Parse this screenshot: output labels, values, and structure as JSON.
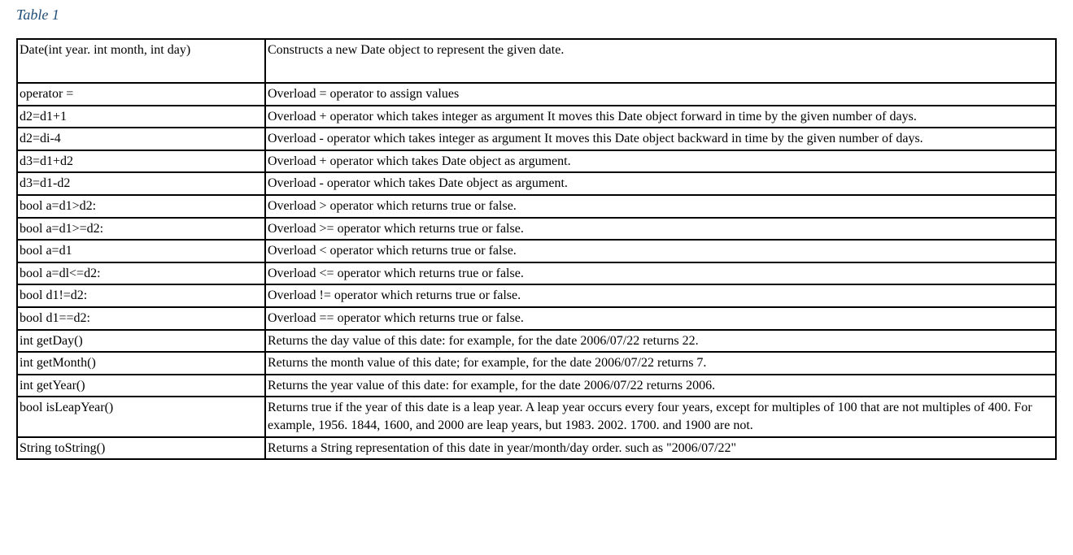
{
  "title": "Table 1",
  "rows": [
    {
      "tall": true,
      "sig": "Date(int year. int month, int day)",
      "desc": "Constructs a new Date object to represent the given date."
    },
    {
      "tall": false,
      "sig": "operator =",
      "desc": "Overload = operator to assign values"
    },
    {
      "tall": false,
      "sig": "d2=d1+1",
      "desc": "Overload + operator which takes integer as argument It moves this Date object forward in time by the given number of days."
    },
    {
      "tall": false,
      "sig": "d2=di-4",
      "desc": "Overload - operator which takes integer as argument It moves this Date object backward in time by the given number of days."
    },
    {
      "tall": false,
      "sig": "d3=d1+d2",
      "desc": "Overload + operator which takes Date object as argument."
    },
    {
      "tall": false,
      "sig": "d3=d1-d2",
      "desc": "Overload - operator which takes Date object as argument."
    },
    {
      "tall": false,
      "sig": "bool a=d1>d2:",
      "desc": "Overload > operator which returns true or false."
    },
    {
      "tall": false,
      "sig": "bool a=d1>=d2:",
      "desc": "Overload >= operator which returns true or false."
    },
    {
      "tall": false,
      "sig": "bool a=d1",
      "desc": "Overload < operator which returns true or false."
    },
    {
      "tall": false,
      "sig": "bool a=dl<=d2:",
      "desc": "Overload <= operator which returns true or false."
    },
    {
      "tall": false,
      "sig": "bool d1!=d2:",
      "desc": "Overload != operator which returns true or false."
    },
    {
      "tall": false,
      "sig": "bool d1==d2:",
      "desc": "Overload == operator which returns true or false."
    },
    {
      "tall": false,
      "sig": "int getDay()",
      "desc": "Returns the day value of this date: for example, for the date 2006/07/22 returns 22."
    },
    {
      "tall": false,
      "sig": "int getMonth()",
      "desc": "Returns the month value of this date; for example, for the date 2006/07/22 returns 7."
    },
    {
      "tall": false,
      "sig": "int getYear()",
      "desc": "Returns the year value of this date: for example, for the date 2006/07/22 returns 2006."
    },
    {
      "tall": false,
      "sig": "bool isLeapYear()",
      "desc": "Returns true if the year of this date is a leap year. A leap year occurs every four years, except for multiples of 100 that are not multiples of 400. For example, 1956. 1844, 1600, and 2000 are leap years, but 1983. 2002. 1700. and 1900 are not."
    },
    {
      "tall": false,
      "sig": "String toString()",
      "desc": "Returns a String representation of this date in year/month/day order. such as \"2006/07/22\""
    }
  ]
}
